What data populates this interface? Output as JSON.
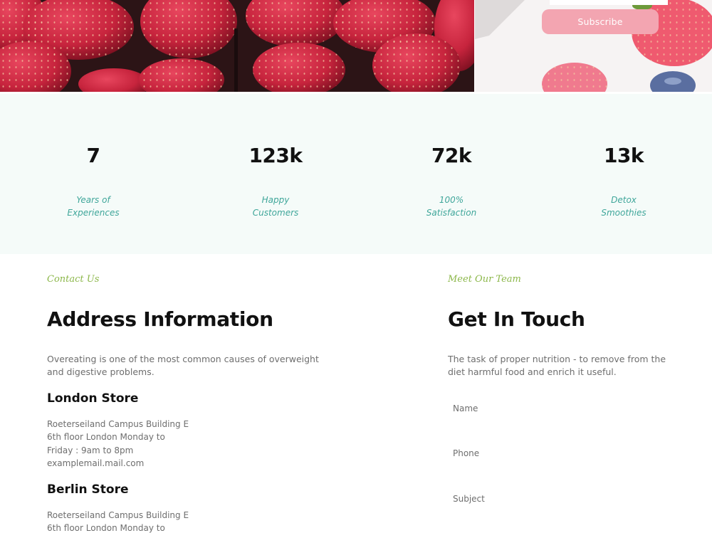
{
  "subscribe": {
    "button_label": "Subscribe",
    "email_placeholder": ""
  },
  "stats": [
    {
      "number": "7",
      "label": "Years of\nExperiences"
    },
    {
      "number": "123k",
      "label": "Happy\nCustomers"
    },
    {
      "number": "72k",
      "label": "100%\nSatisfaction"
    },
    {
      "number": "13k",
      "label": "Detox\nSmoothies"
    }
  ],
  "contact": {
    "eyebrow": "Contact Us",
    "title": "Address Information",
    "description": "Overeating is one of the most common causes of overweight and digestive problems.",
    "stores": [
      {
        "name": "London Store",
        "lines": [
          "Roeterseiland Campus Building E",
          "6th floor London Monday to",
          "Friday : 9am to 8pm",
          "examplemail.mail.com"
        ]
      },
      {
        "name": "Berlin Store",
        "lines": [
          "Roeterseiland Campus Building E",
          "6th floor London Monday to"
        ]
      }
    ]
  },
  "touch": {
    "eyebrow": "Meet Our Team",
    "title": "Get In Touch",
    "description": "The task of proper nutrition - to remove from the diet harmful food and enrich it useful.",
    "fields": {
      "name_placeholder": "Name",
      "phone_placeholder": "Phone",
      "subject_placeholder": "Subject"
    }
  },
  "colors": {
    "accent_pink": "#f3a5b1",
    "stats_background": "#f5fbf9",
    "stat_label_teal": "#3fa69a",
    "eyebrow_green": "#8cb74a"
  }
}
